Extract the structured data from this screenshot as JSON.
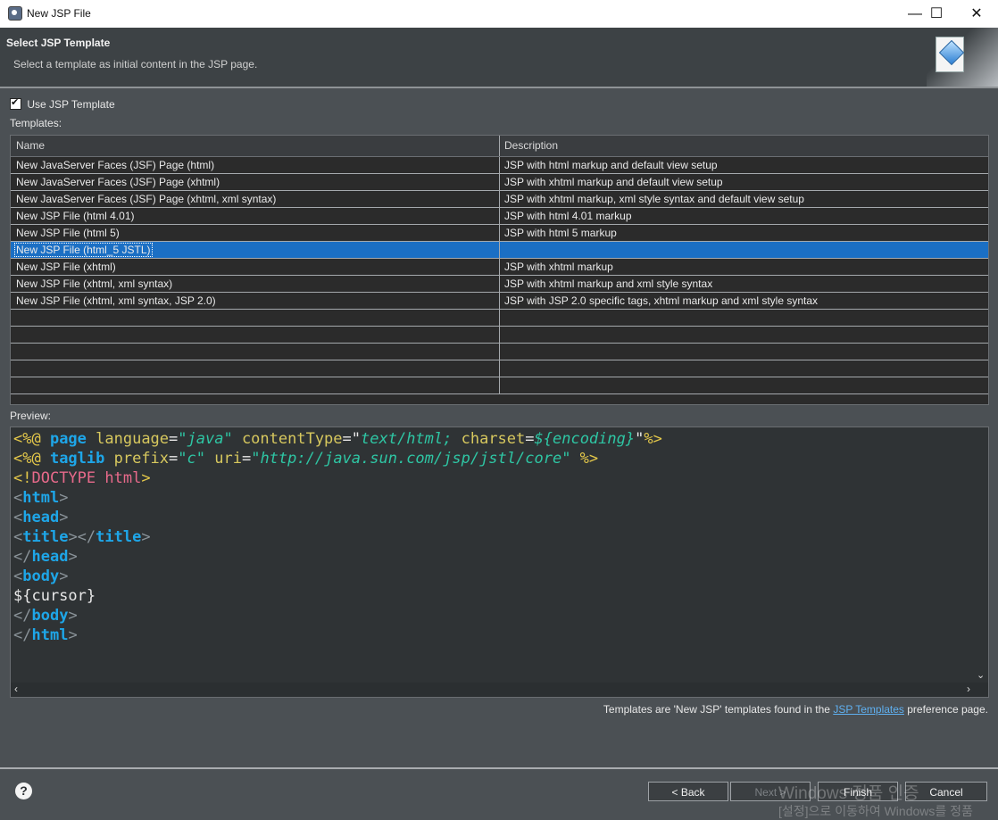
{
  "window": {
    "title": "New JSP File",
    "minimize": "—",
    "maximize": "☐",
    "close": "✕"
  },
  "header": {
    "title": "Select JSP Template",
    "description": "Select a template as initial content in the JSP page."
  },
  "use_template": {
    "label": "Use JSP Template",
    "checked": true
  },
  "templates_label": "Templates:",
  "table": {
    "headers": {
      "name": "Name",
      "description": "Description"
    },
    "rows": [
      {
        "name": "New JavaServer Faces (JSF) Page (html)",
        "description": "JSP with html markup and default view setup"
      },
      {
        "name": "New JavaServer Faces (JSF) Page (xhtml)",
        "description": "JSP with xhtml markup and default view setup"
      },
      {
        "name": "New JavaServer Faces (JSF) Page (xhtml, xml syntax)",
        "description": "JSP with xhtml markup, xml style syntax and default view setup"
      },
      {
        "name": "New JSP File (html 4.01)",
        "description": "JSP with html 4.01 markup"
      },
      {
        "name": "New JSP File (html 5)",
        "description": "JSP with html 5 markup"
      },
      {
        "name": "New JSP File (html_5 JSTL)",
        "description": "",
        "selected": true
      },
      {
        "name": "New JSP File (xhtml)",
        "description": "JSP with xhtml markup"
      },
      {
        "name": "New JSP File (xhtml, xml syntax)",
        "description": "JSP with xhtml markup and xml style syntax"
      },
      {
        "name": "New JSP File (xhtml, xml syntax, JSP 2.0)",
        "description": "JSP with JSP 2.0 specific tags, xhtml markup and xml style syntax"
      }
    ],
    "empty_rows": 5
  },
  "preview_label": "Preview:",
  "preview_code": [
    [
      [
        "dir",
        "<%@ "
      ],
      [
        "kw",
        "page "
      ],
      [
        "attr",
        "language"
      ],
      [
        "plain",
        "="
      ],
      [
        "val",
        "\"java\" "
      ],
      [
        "attr",
        "contentType"
      ],
      [
        "plain",
        "=\""
      ],
      [
        "val",
        "text/html; "
      ],
      [
        "attr",
        "charset"
      ],
      [
        "plain",
        "="
      ],
      [
        "val",
        "${encoding}"
      ],
      [
        "plain",
        "\""
      ],
      [
        "dir",
        "%>"
      ]
    ],
    [
      [
        "dir",
        "<%@ "
      ],
      [
        "kw",
        "taglib "
      ],
      [
        "attr",
        "prefix"
      ],
      [
        "plain",
        "="
      ],
      [
        "val",
        "\"c\" "
      ],
      [
        "attr",
        "uri"
      ],
      [
        "plain",
        "="
      ],
      [
        "val",
        "\"http://java.sun.com/jsp/jstl/core\" "
      ],
      [
        "dir",
        "%>"
      ]
    ],
    [
      [
        "dir",
        "<!"
      ],
      [
        "pink",
        "DOCTYPE "
      ],
      [
        "pink",
        "html"
      ],
      [
        "dir",
        ">"
      ]
    ],
    [
      [
        "gt",
        "<"
      ],
      [
        "kw",
        "html"
      ],
      [
        "gt",
        ">"
      ]
    ],
    [
      [
        "gt",
        "<"
      ],
      [
        "kw",
        "head"
      ],
      [
        "gt",
        ">"
      ]
    ],
    [
      [
        "gt",
        "<"
      ],
      [
        "kw",
        "title"
      ],
      [
        "gt",
        "></"
      ],
      [
        "kw",
        "title"
      ],
      [
        "gt",
        ">"
      ]
    ],
    [
      [
        "gt",
        "</"
      ],
      [
        "kw",
        "head"
      ],
      [
        "gt",
        ">"
      ]
    ],
    [
      [
        "gt",
        "<"
      ],
      [
        "kw",
        "body"
      ],
      [
        "gt",
        ">"
      ]
    ],
    [
      [
        "plain",
        "${cursor}"
      ]
    ],
    [
      [
        "gt",
        "</"
      ],
      [
        "kw",
        "body"
      ],
      [
        "gt",
        ">"
      ]
    ],
    [
      [
        "gt",
        "</"
      ],
      [
        "kw",
        "html"
      ],
      [
        "gt",
        ">"
      ]
    ]
  ],
  "footer": {
    "text_before": "Templates are 'New JSP' templates found in the ",
    "link": "JSP Templates",
    "text_after": " preference page."
  },
  "buttons": {
    "help": "?",
    "back": "< Back",
    "next": "Next >",
    "finish": "Finish",
    "cancel": "Cancel"
  },
  "watermark": {
    "line1": "Windows 정품 인증",
    "line2": "[설정]으로 이동하여 Windows를 정품"
  }
}
